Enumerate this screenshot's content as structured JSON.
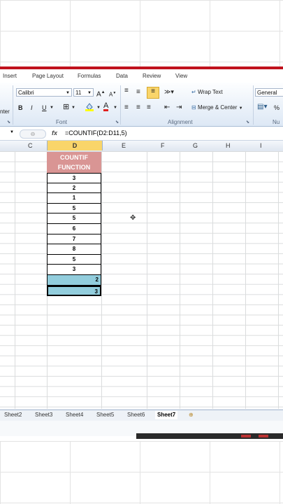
{
  "menu": [
    "Insert",
    "Page Layout",
    "Formulas",
    "Data",
    "Review",
    "View"
  ],
  "ribbon": {
    "font_name": "Calibri",
    "font_size": "11",
    "grow_font": "A",
    "shrink_font": "A",
    "bold": "B",
    "italic": "I",
    "underline": "U",
    "font_color": "A",
    "wrap_text": "Wrap Text",
    "merge_center": "Merge & Center",
    "number_format": "General",
    "percent": "%",
    "partial_center": "nter",
    "group_font": "Font",
    "group_alignment": "Alignment",
    "group_number_partial": "Nu"
  },
  "formula_bar": {
    "fx": "fx",
    "formula": "=COUNTIF(D2:D11,5)"
  },
  "columns": [
    "C",
    "D",
    "E",
    "F",
    "G",
    "H",
    "I"
  ],
  "header_cell": {
    "line1": "COUNTIF",
    "line2": "FUNCTION",
    "bg": "#d99594"
  },
  "values": [
    "3",
    "2",
    "1",
    "5",
    "5",
    "6",
    "7",
    "8",
    "5",
    "3"
  ],
  "results": [
    "2",
    "3"
  ],
  "result_bg": "#92cddc",
  "sheet_tabs": [
    "Sheet2",
    "Sheet3",
    "Sheet4",
    "Sheet5",
    "Sheet6",
    "Sheet7"
  ],
  "active_sheet": "Sheet7"
}
